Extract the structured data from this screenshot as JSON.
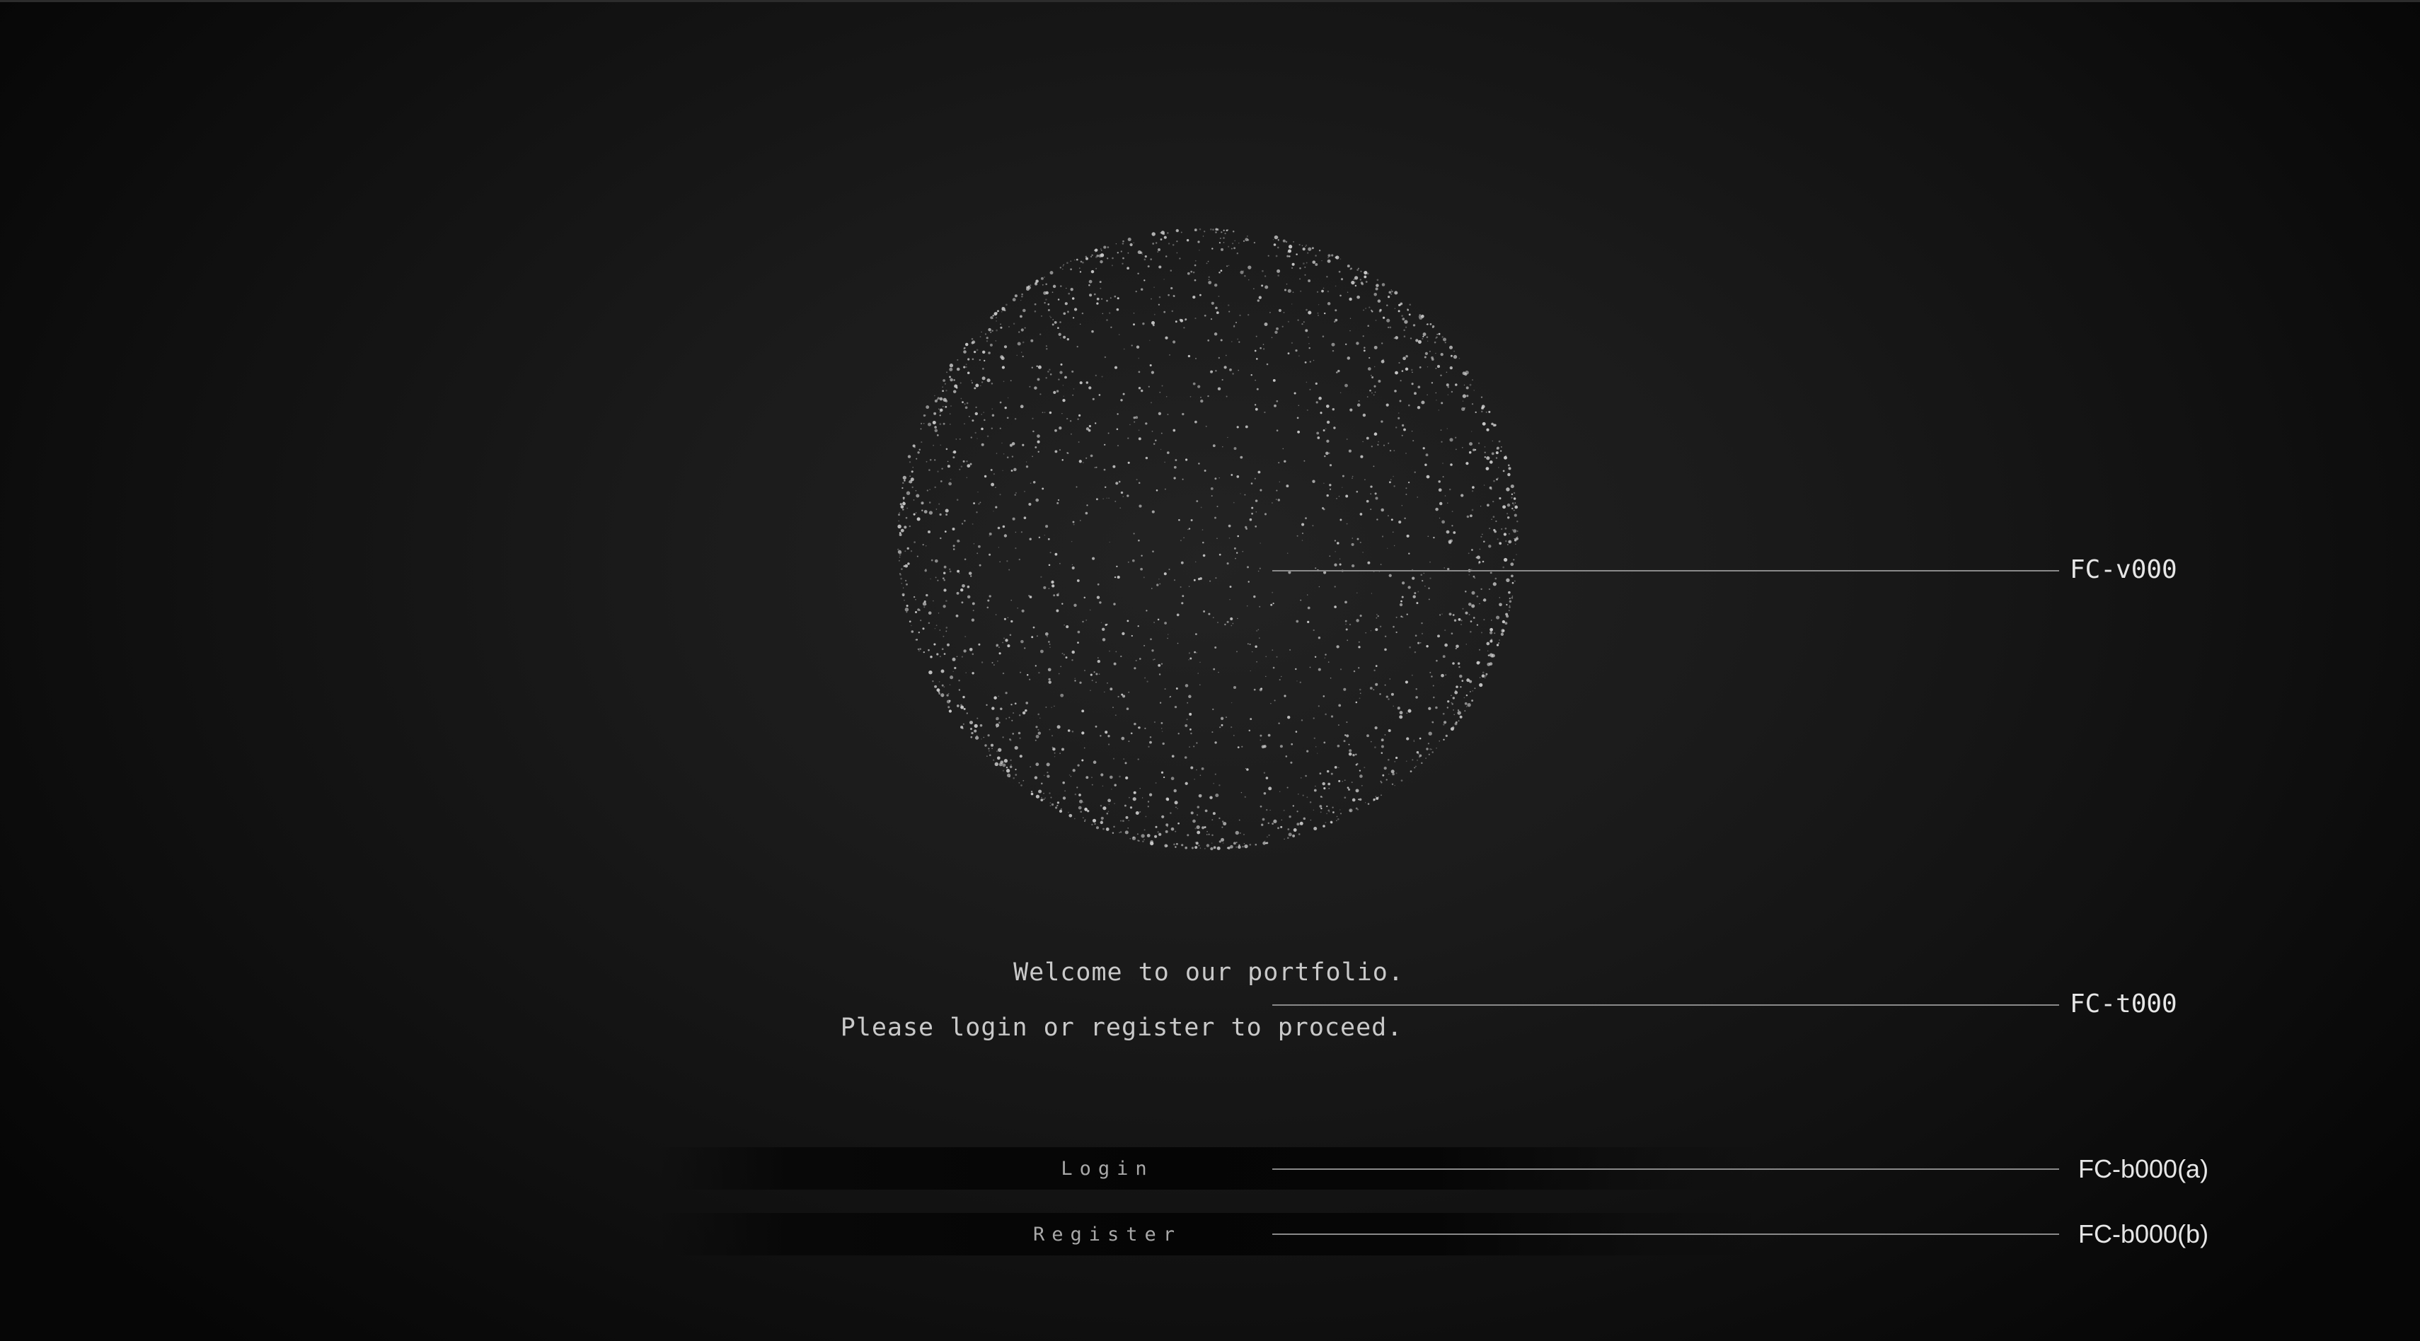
{
  "welcome": {
    "line1": "Welcome to our portfolio.",
    "line2": "Please login or register to proceed."
  },
  "buttons": {
    "login_label": "Login",
    "register_label": "Register"
  },
  "callouts": {
    "visual": "FC-v000",
    "text": "FC-t000",
    "button_a": "FC-b000(a)",
    "button_b": "FC-b000(b)"
  },
  "colors": {
    "background": "#1a1a1a",
    "particle": "#cfcfcf",
    "text": "#c9c9c9",
    "callout_line": "#8a8a8a"
  }
}
